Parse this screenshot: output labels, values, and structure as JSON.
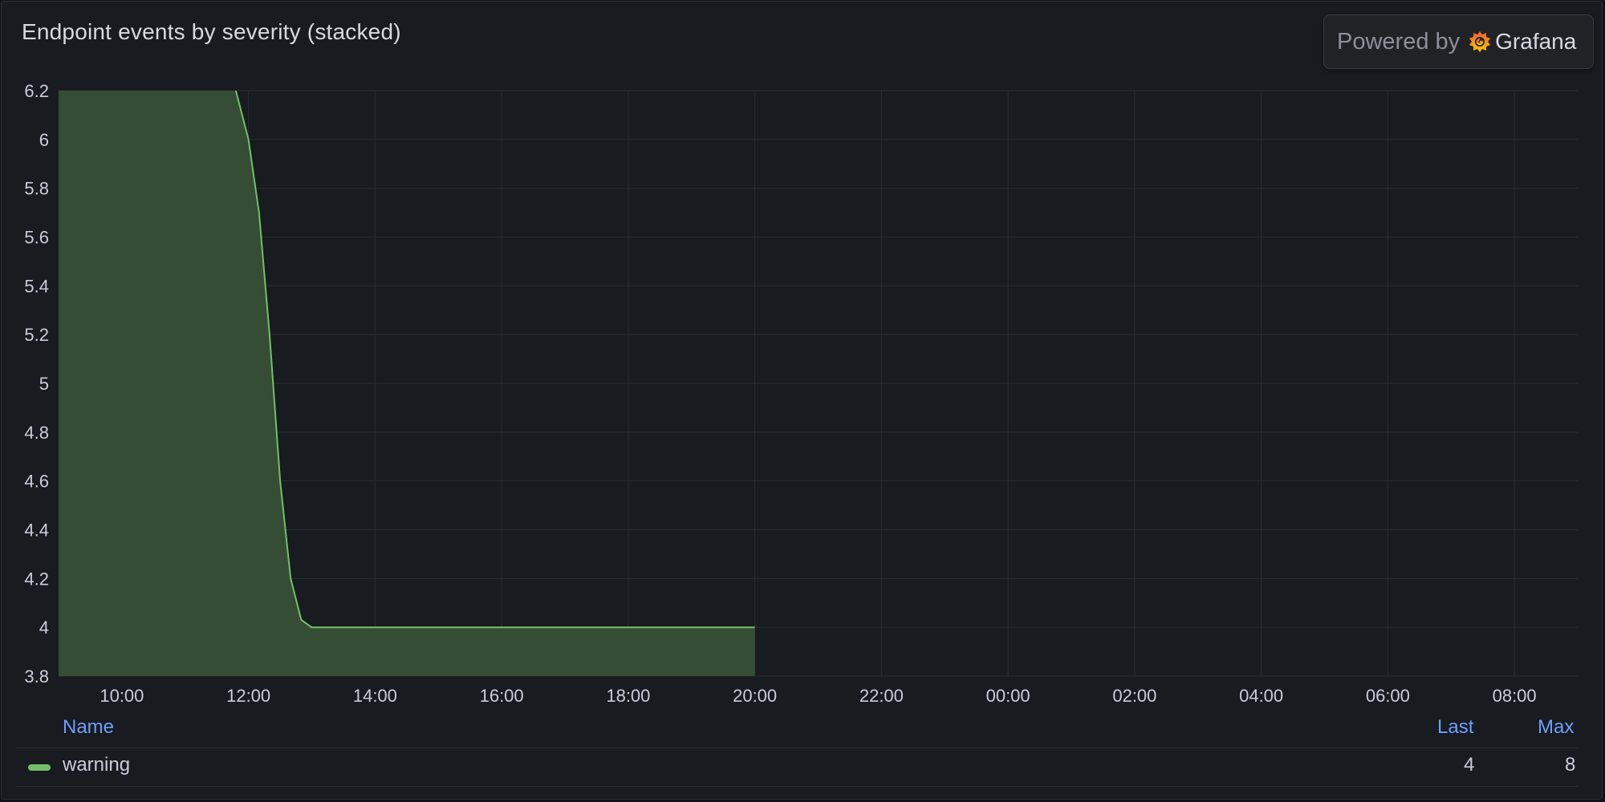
{
  "panel": {
    "title": "Endpoint events by severity (stacked)"
  },
  "branding": {
    "powered_by": "Powered by",
    "brand": "Grafana"
  },
  "colors": {
    "series_line": "#73bf69",
    "series_fill": "#344d34",
    "grid": "#2a2d33",
    "axis_text": "#ccccdc",
    "legend_header": "#6e9fff"
  },
  "chart_data": {
    "type": "area",
    "title": "Endpoint events by severity (stacked)",
    "xlabel": "",
    "ylabel": "",
    "ylim": [
      3.8,
      6.2
    ],
    "yticks": [
      "3.8",
      "4",
      "4.2",
      "4.4",
      "4.6",
      "4.8",
      "5",
      "5.2",
      "5.4",
      "5.6",
      "5.8",
      "6",
      "6.2"
    ],
    "xlim": [
      "09:00",
      "09:00 (+1 day)"
    ],
    "xticks": [
      "10:00",
      "12:00",
      "14:00",
      "16:00",
      "18:00",
      "20:00",
      "22:00",
      "00:00",
      "02:00",
      "04:00",
      "06:00",
      "08:00"
    ],
    "grid": true,
    "series": [
      {
        "name": "warning",
        "x": [
          "09:00",
          "11:48",
          "12:00",
          "12:10",
          "12:20",
          "12:30",
          "12:40",
          "12:50",
          "13:00",
          "14:00",
          "16:00",
          "18:00",
          "20:00"
        ],
        "y": [
          8,
          6.2,
          6.0,
          5.7,
          5.2,
          4.6,
          4.2,
          4.03,
          4,
          4,
          4,
          4,
          4
        ]
      }
    ],
    "legend": {
      "placement": "bottom",
      "columns": [
        "Name",
        "Last",
        "Max"
      ],
      "rows": [
        {
          "name": "warning",
          "last": "4",
          "max": "8"
        }
      ]
    }
  }
}
